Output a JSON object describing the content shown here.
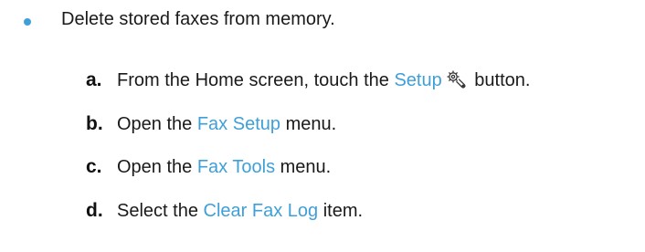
{
  "bullet": {
    "text": "Delete stored faxes from memory."
  },
  "steps": [
    {
      "letter": "a.",
      "before": "From the Home screen, touch the ",
      "link": "Setup",
      "after": " button.",
      "icon": "setup-wrench-gear-icon"
    },
    {
      "letter": "b.",
      "before": "Open the ",
      "link": "Fax Setup",
      "after": " menu."
    },
    {
      "letter": "c.",
      "before": "Open the ",
      "link": "Fax Tools",
      "after": " menu."
    },
    {
      "letter": "d.",
      "before": "Select the ",
      "link": "Clear Fax Log",
      "after": " item."
    }
  ],
  "colors": {
    "link": "#3f9fd8",
    "bullet": "#3f9fd8",
    "text": "#1a1a1a"
  }
}
